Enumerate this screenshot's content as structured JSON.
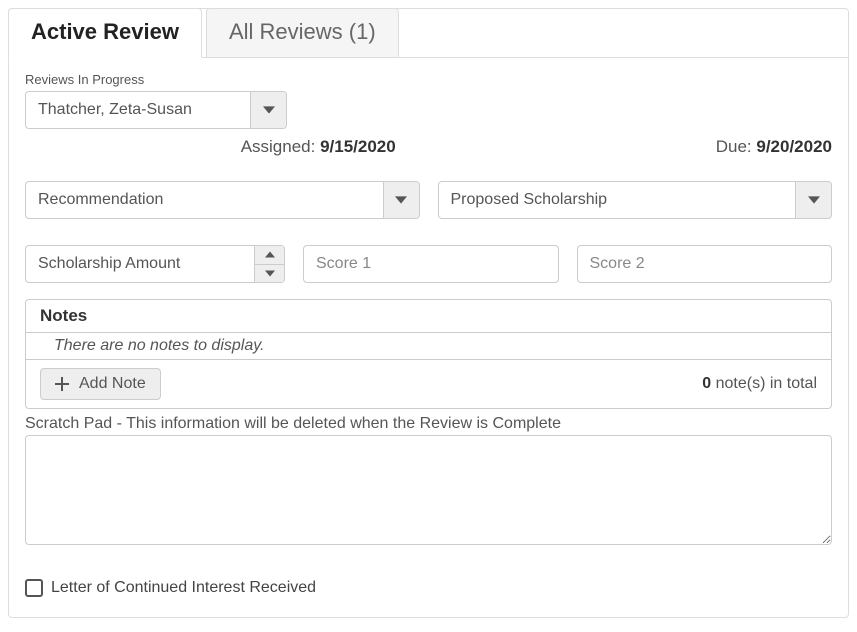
{
  "tabs": {
    "active": "Active Review",
    "all": "All Reviews (1)"
  },
  "reviewsInProgress": {
    "label": "Reviews In Progress",
    "selected": "Thatcher, Zeta-Susan"
  },
  "meta": {
    "assigned_label": "Assigned: ",
    "assigned_value": "9/15/2020",
    "due_label": "Due: ",
    "due_value": "9/20/2020"
  },
  "recommendation": {
    "placeholder": "Recommendation"
  },
  "proposed": {
    "placeholder": "Proposed Scholarship"
  },
  "amount": {
    "placeholder": "Scholarship Amount"
  },
  "score1": {
    "placeholder": "Score 1"
  },
  "score2": {
    "placeholder": "Score 2"
  },
  "notes": {
    "header": "Notes",
    "empty": "There are no notes to display.",
    "add_label": "Add Note",
    "count": "0",
    "count_suffix": " note(s) in total"
  },
  "scratch": {
    "label": "Scratch Pad - This information will be deleted when the Review is Complete"
  },
  "loci": {
    "label": "Letter of Continued Interest Received"
  }
}
